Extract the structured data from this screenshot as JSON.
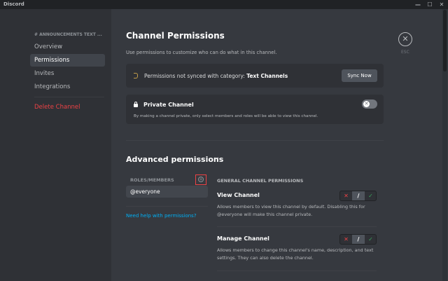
{
  "window": {
    "title": "Discord",
    "minimize": "—",
    "maximize": "☐",
    "close": "✕"
  },
  "sidebar": {
    "header": "# ANNOUNCEMENTS TEXT ...",
    "items": [
      {
        "label": "Overview"
      },
      {
        "label": "Permissions"
      },
      {
        "label": "Invites"
      },
      {
        "label": "Integrations"
      }
    ],
    "delete_label": "Delete Channel"
  },
  "main": {
    "title": "Channel Permissions",
    "subtitle": "Use permissions to customize who can do what in this channel.",
    "esc_icon": "✕",
    "esc_label": "ESC",
    "sync_card": {
      "text": "Permissions not synced with category:",
      "category": "Text Channels",
      "button": "Sync Now"
    },
    "private_card": {
      "title": "Private Channel",
      "description": "By making a channel private, only select members and roles will be able to view this channel.",
      "toggle_icon": "✕"
    },
    "advanced": {
      "title": "Advanced permissions",
      "chevron": "⌄",
      "roles_label": "ROLES/MEMBERS",
      "add_icon": "+",
      "roles": [
        "@everyone"
      ],
      "help_link": "Need help with permissions?",
      "general_label": "GENERAL CHANNEL PERMISSIONS",
      "permissions": [
        {
          "title": "View Channel",
          "description": "Allows members to view this channel by default. Disabling this for @everyone will make this channel private.",
          "deny": "✕",
          "neutral": "/",
          "allow": "✓"
        },
        {
          "title": "Manage Channel",
          "description": "Allows members to change this channel's name, description, and text settings. They can also delete the channel.",
          "deny": "✕",
          "neutral": "/",
          "allow": "✓"
        }
      ]
    }
  },
  "colors": {
    "danger": "#ed4245",
    "link": "#00aff4",
    "success": "#3ba55d",
    "warning": "#c09c4a"
  }
}
